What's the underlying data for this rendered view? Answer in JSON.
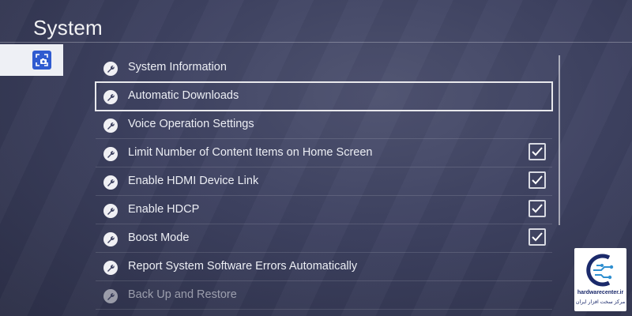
{
  "header": {
    "title": "System"
  },
  "sidebar": {
    "active_icon": "screen-capture-icon"
  },
  "menu": {
    "items": [
      {
        "label": "System Information",
        "checked": null
      },
      {
        "label": "Automatic Downloads",
        "checked": null,
        "selected": true
      },
      {
        "label": "Voice Operation Settings",
        "checked": null
      },
      {
        "label": "Limit Number of Content Items on Home Screen",
        "checked": true
      },
      {
        "label": "Enable HDMI Device Link",
        "checked": true
      },
      {
        "label": "Enable HDCP",
        "checked": true
      },
      {
        "label": "Boost Mode",
        "checked": true
      },
      {
        "label": "Report System Software Errors Automatically",
        "checked": null
      },
      {
        "label": "Back Up and Restore",
        "checked": null
      }
    ]
  },
  "watermark": {
    "site": "hardwarecenter.ir",
    "tagline": "مرکز سخت افزار ایران"
  },
  "colors": {
    "accent": "#2f5bd0",
    "background": "#3d4160",
    "text": "#eceef4"
  }
}
